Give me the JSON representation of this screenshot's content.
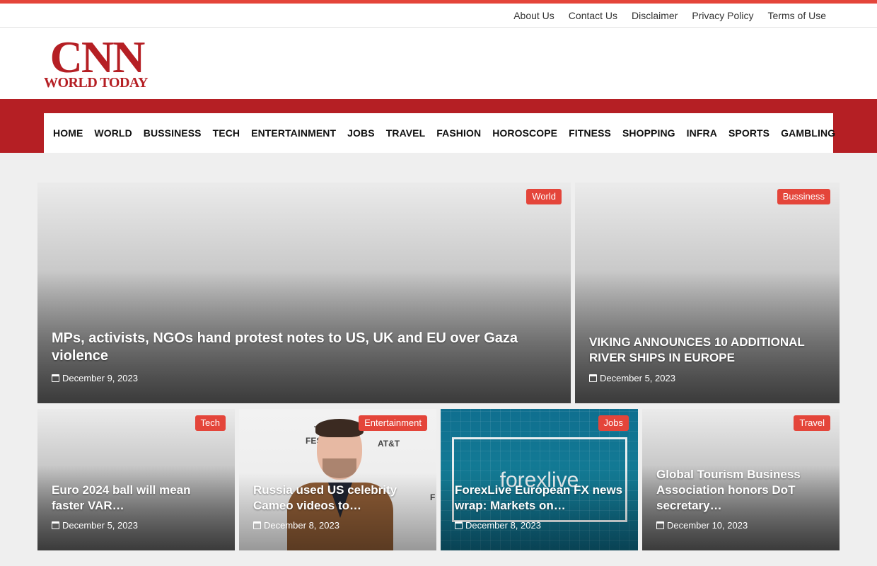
{
  "colors": {
    "accent": "#e4453a",
    "brand": "#b51f24"
  },
  "top_links": [
    "About Us",
    "Contact Us",
    "Disclaimer",
    "Privacy Policy",
    "Terms of Use"
  ],
  "logo": {
    "main": "CNN",
    "sub": "WORLD TODAY"
  },
  "nav": [
    "HOME",
    "WORLD",
    "BUSSINESS",
    "TECH",
    "ENTERTAINMENT",
    "JOBS",
    "TRAVEL",
    "FASHION",
    "HOROSCOPE",
    "FITNESS",
    "SHOPPING",
    "INFRA",
    "SPORTS",
    "GAMBLING"
  ],
  "featured": [
    {
      "category": "World",
      "title": "MPs, activists, NGOs hand protest notes to US, UK and EU over Gaza violence",
      "date": "December 9, 2023"
    },
    {
      "category": "Bussiness",
      "title": "VIKING ANNOUNCES 10 ADDITIONAL RIVER SHIPS IN EUROPE",
      "date": "December 5, 2023"
    }
  ],
  "grid": [
    {
      "category": "Tech",
      "title": "Euro 2024 ball will mean faster VAR…",
      "date": "December 5, 2023"
    },
    {
      "category": "Entertainment",
      "title": "Russia used US celebrity Cameo videos to…",
      "date": "December 8, 2023",
      "photo_text": [
        "T",
        "FES",
        "AT&T",
        "F"
      ]
    },
    {
      "category": "Jobs",
      "title": "ForexLive European FX news wrap: Markets on…",
      "date": "December 8, 2023",
      "photo_text": "forexlive"
    },
    {
      "category": "Travel",
      "title": "Global Tourism Business Association honors DoT secretary…",
      "date": "December 10, 2023"
    }
  ],
  "icons": {
    "date": "calendar-icon"
  }
}
